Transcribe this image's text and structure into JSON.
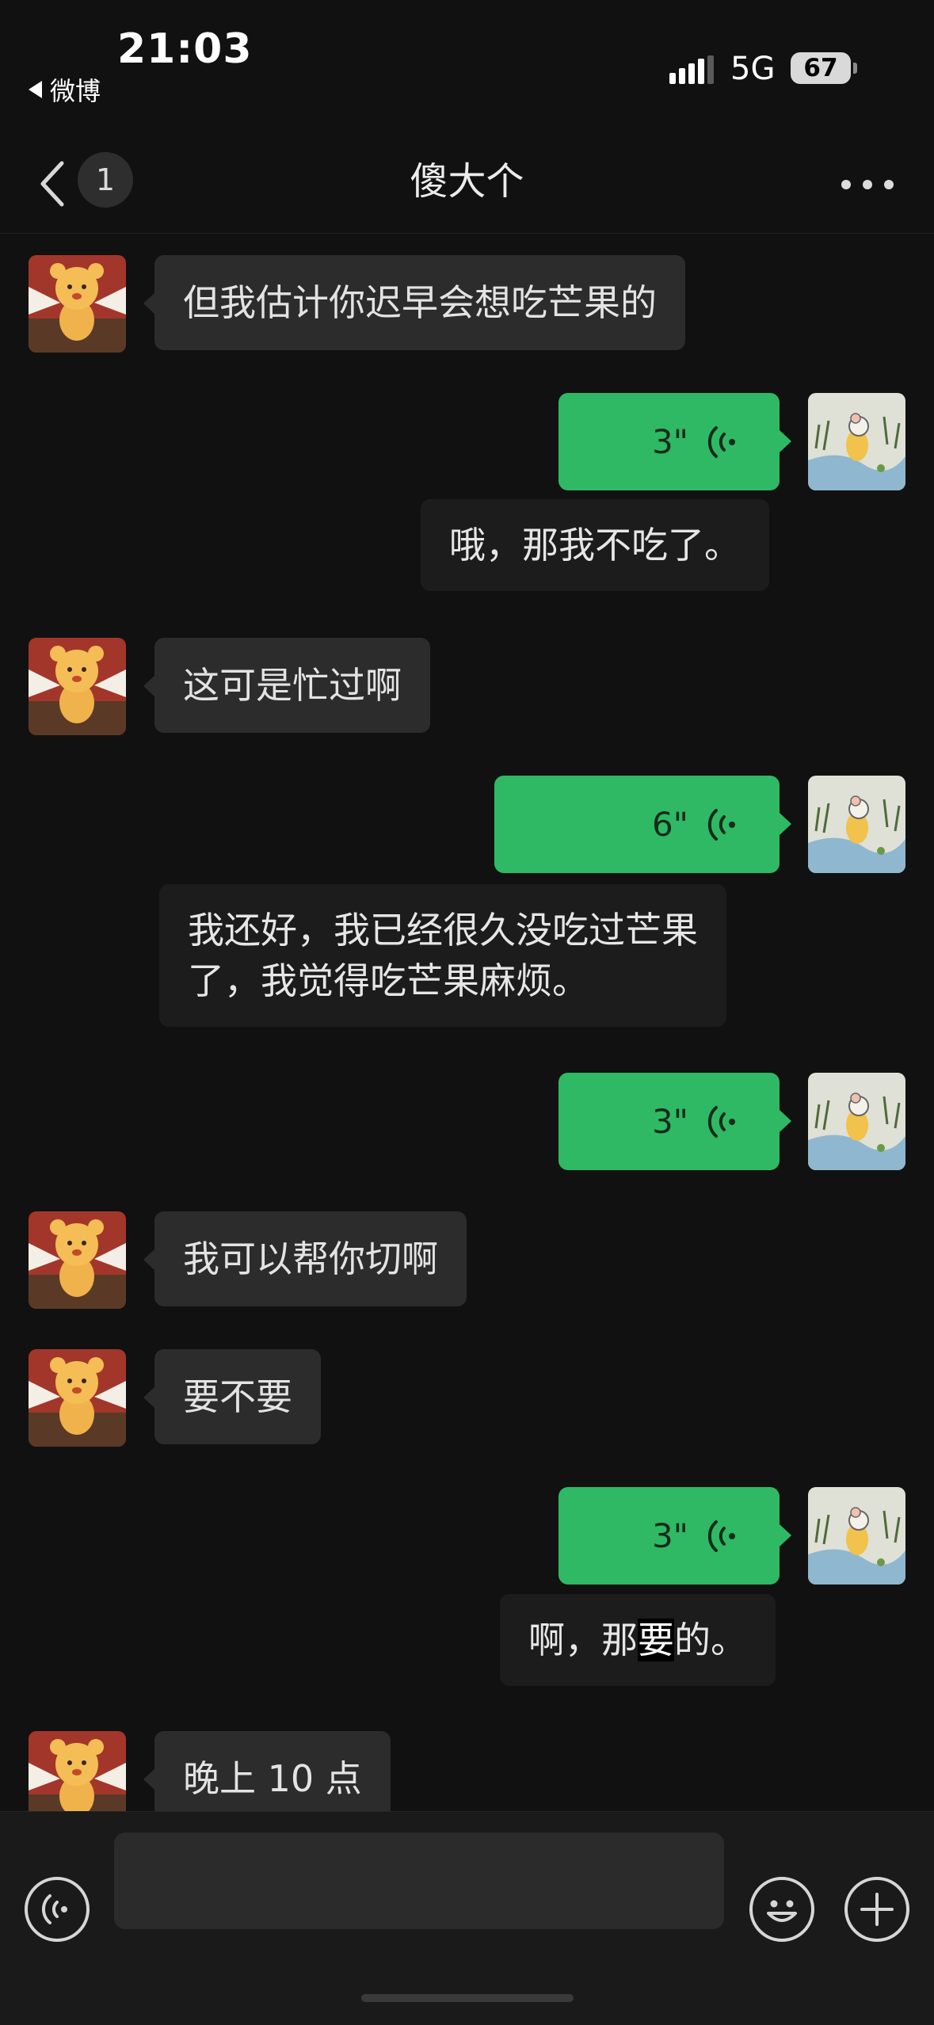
{
  "status_bar": {
    "time": "21:03",
    "back_app_label": "微博",
    "network": "5G",
    "battery": "67"
  },
  "header": {
    "title": "傻大个",
    "unread_count": "1"
  },
  "messages": [
    {
      "kind": "text",
      "side": "left",
      "text": "但我估计你迟早会想吃芒果的"
    },
    {
      "kind": "voice",
      "side": "right",
      "duration": "3\""
    },
    {
      "kind": "transcript",
      "text": "哦，那我不吃了。"
    },
    {
      "kind": "text",
      "side": "left",
      "text": "这可是忙过啊"
    },
    {
      "kind": "voice",
      "side": "right",
      "duration": "6\""
    },
    {
      "kind": "transcript",
      "lines": [
        "我还好，我已经很久没吃过芒果",
        "了，我觉得吃芒果麻烦。"
      ]
    },
    {
      "kind": "voice",
      "side": "right",
      "duration": "3\""
    },
    {
      "kind": "text",
      "side": "left",
      "text": "我可以帮你切啊"
    },
    {
      "kind": "text",
      "side": "left",
      "text": "要不要"
    },
    {
      "kind": "voice",
      "side": "right",
      "duration": "3\""
    },
    {
      "kind": "transcript",
      "parts": [
        "啊，那",
        "要",
        "的。"
      ]
    },
    {
      "kind": "text",
      "side": "left",
      "text": "晚上 10 点"
    }
  ],
  "input": {
    "placeholder": ""
  },
  "colors": {
    "background": "#111111",
    "voice_bubble": "#2fb964",
    "incoming_bubble": "#2c2c2c",
    "transcript_bubble": "#1c1c1c"
  },
  "icons": [
    "back-chevron-icon",
    "more-dots-icon",
    "voice-wave-icon",
    "voice-input-icon",
    "emoji-icon",
    "plus-icon",
    "signal-icon"
  ]
}
